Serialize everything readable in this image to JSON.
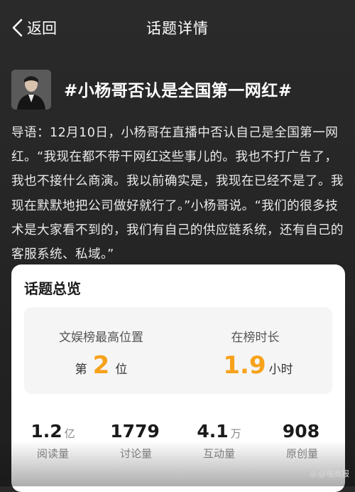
{
  "nav": {
    "back_label": "返回",
    "title": "话题详情"
  },
  "topic": {
    "title": "#小杨哥否认是全国第一网红#",
    "avatar_icon": "person-avatar"
  },
  "intro": {
    "label": "导语：",
    "text": "12月10日，小杨哥在直播中否认自己是全国第一网红。“我现在都不带干网红这些事儿的。我也不打广告了，我也不接什么商演。我以前确实是，我现在已经不是了。我现在默默地把公司做好就行了。”小杨哥说。“我们的很多技术是大家看不到的，我们有自己的供应链系统，还有自己的客服系统、私域。”"
  },
  "overview": {
    "title": "话题总览",
    "rank": {
      "label": "文娱榜最高位置",
      "prefix": "第",
      "value": "2",
      "unit": "位"
    },
    "duration": {
      "label": "在榜时长",
      "value": "1.9",
      "unit": "小时"
    },
    "stats": [
      {
        "value": "1.2",
        "unit": "亿",
        "label": "阅读量"
      },
      {
        "value": "1779",
        "unit": "",
        "label": "讨论量"
      },
      {
        "value": "4.1",
        "unit": "万",
        "label": "互动量"
      },
      {
        "value": "908",
        "unit": "",
        "label": "原创量"
      }
    ],
    "accent_color": "#f7a21b"
  },
  "watermark": {
    "text": "@电商报"
  }
}
